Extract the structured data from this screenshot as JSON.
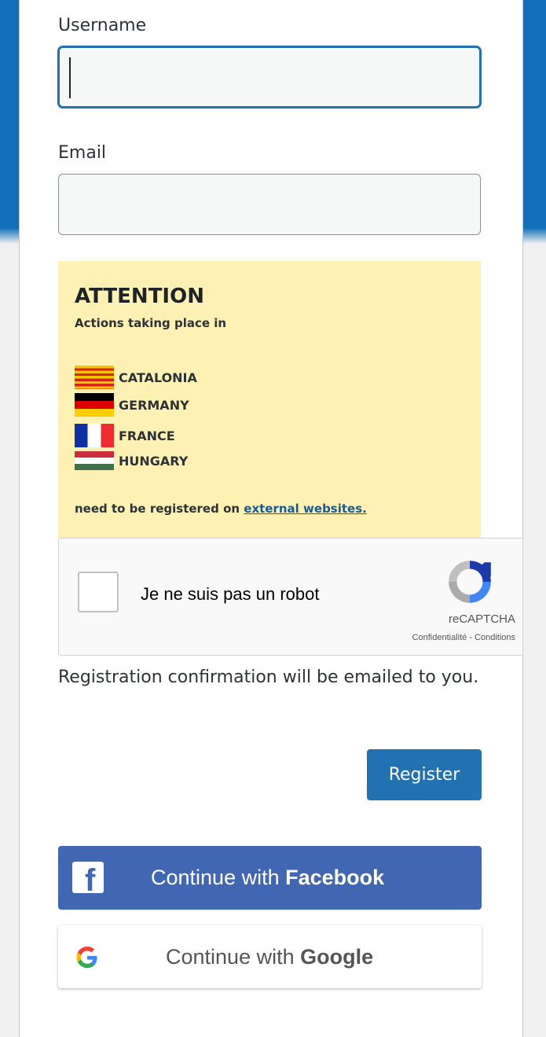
{
  "form": {
    "username_label": "Username",
    "username_value": "",
    "email_label": "Email",
    "email_value": ""
  },
  "notice": {
    "title": "ATTENTION",
    "subtitle": "Actions taking place in",
    "countries": [
      {
        "name": "CATALONIA",
        "flag": "catalonia-flag"
      },
      {
        "name": "GERMANY",
        "flag": "germany-flag"
      },
      {
        "name": "FRANCE",
        "flag": "france-flag"
      },
      {
        "name": "HUNGARY",
        "flag": "hungary-flag"
      }
    ],
    "footer_text": "need to be registered on ",
    "footer_link": "external websites.",
    "background_color": "#fff0b3"
  },
  "captcha": {
    "checkbox_label": "Je ne suis pas un robot",
    "brand": "reCAPTCHA",
    "links": "Confidentialité - Conditions",
    "checked": false
  },
  "confirmation_text": "Registration confirmation will be emailed to you.",
  "register_button": "Register",
  "social": {
    "facebook_prefix": "Continue with ",
    "facebook_brand": "Facebook",
    "facebook_color": "#4267b2",
    "google_prefix": "Continue with ",
    "google_brand": "Google"
  },
  "colors": {
    "header_blue": "#1170b8",
    "primary_button": "#2271b1"
  }
}
